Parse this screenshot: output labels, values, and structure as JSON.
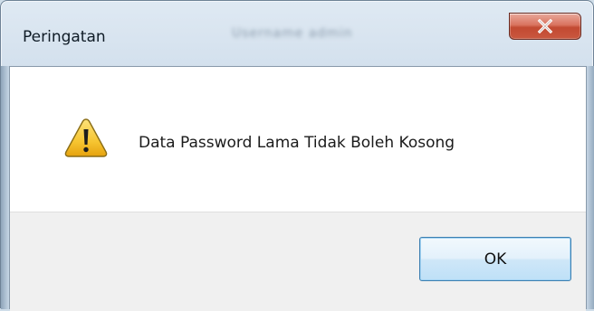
{
  "dialog": {
    "title": "Peringatan",
    "background_title_text": "Username  admin",
    "message": "Data Password Lama Tidak Boleh Kosong",
    "icon": "warning-icon",
    "ok_label": "OK",
    "close_icon": "close-icon"
  },
  "colors": {
    "close_button": "#c9573e",
    "warning_fill": "#f6c531",
    "ok_border": "#3c7fb1"
  }
}
